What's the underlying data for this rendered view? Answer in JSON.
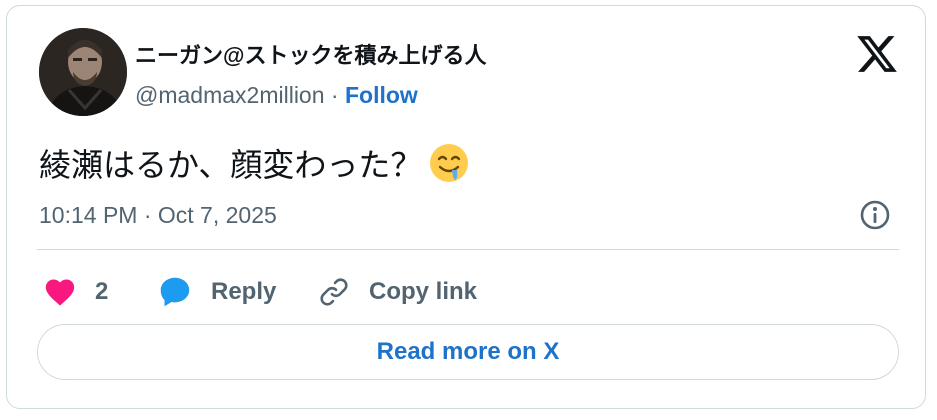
{
  "author": {
    "display_name": "ニーガン@ストックを積み上げる人",
    "handle": "@madmax2million",
    "separator": "·",
    "follow_label": "Follow"
  },
  "tweet": {
    "text": "綾瀬はるか、顔変わった？",
    "emoji_icon": "drooling-face-emoji",
    "timestamp": "10:14 PM · Oct 7, 2025"
  },
  "actions": {
    "like_count": "2",
    "reply_label": "Reply",
    "copy_link_label": "Copy link"
  },
  "read_more_label": "Read more on X",
  "colors": {
    "accent": "#1d73c9",
    "like": "#f91880",
    "reply_icon": "#1d9bf0",
    "muted": "#536471",
    "border": "#cfd9de"
  }
}
